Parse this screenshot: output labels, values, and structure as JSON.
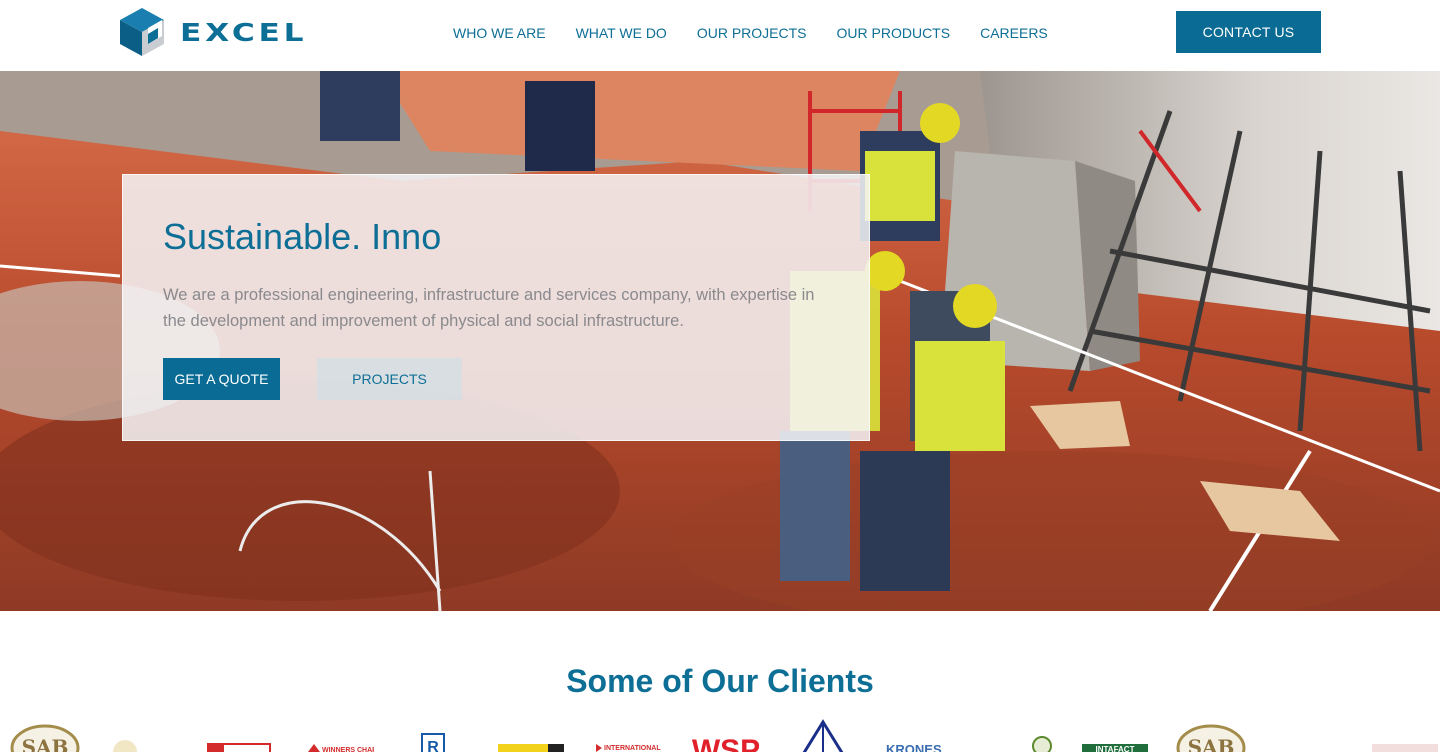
{
  "brand": {
    "name": "EXCEL"
  },
  "nav": {
    "items": [
      "WHO WE ARE",
      "WHAT WE DO",
      "OUR PROJECTS",
      "OUR PRODUCTS",
      "CAREERS"
    ],
    "contact_label": "CONTACT US"
  },
  "hero": {
    "title": "Sustainable. Inno",
    "description": "We are a professional engineering, infrastructure and services company, with expertise in the development and improvement of physical and social infrastructure.",
    "quote_label": "GET A QUOTE",
    "projects_label": "PROJECTS"
  },
  "clients": {
    "title": "Some of Our Clients",
    "logos": [
      "SAB",
      "Winners Chapel",
      "INTERNATIONAL",
      "WSP",
      "KRONES",
      "INTAFACT",
      "SAB"
    ]
  },
  "colors": {
    "accent": "#0e6f96",
    "button": "#0a6b94"
  }
}
